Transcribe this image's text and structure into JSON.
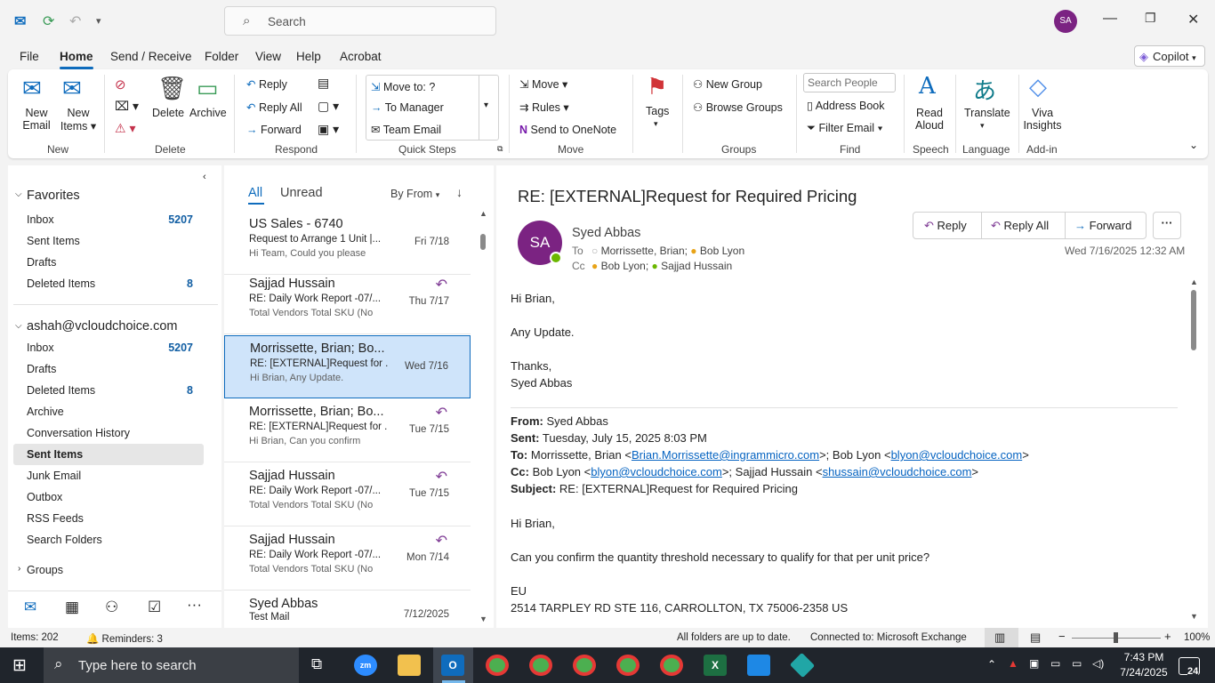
{
  "app": {
    "search_placeholder": "Search",
    "user_initials": "SA",
    "copilot": "Copilot"
  },
  "menu": [
    "File",
    "Home",
    "Send / Receive",
    "Folder",
    "View",
    "Help",
    "Acrobat"
  ],
  "ribbon": {
    "new_email": [
      "New",
      "Email"
    ],
    "new_items": [
      "New",
      "Items"
    ],
    "delete": "Delete",
    "archive": "Archive",
    "reply": "Reply",
    "reply_all": "Reply All",
    "forward": "Forward",
    "qs_move_to": "Move to: ?",
    "qs_to_manager": "To Manager",
    "qs_team_email": "Team Email",
    "move": "Move",
    "rules": "Rules",
    "send_onenote": "Send to OneNote",
    "tags": "Tags",
    "new_group": "New Group",
    "browse_groups": "Browse Groups",
    "search_people_placeholder": "Search People",
    "address_book": "Address Book",
    "filter_email": "Filter Email",
    "read_aloud": [
      "Read",
      "Aloud"
    ],
    "translate": "Translate",
    "viva_insights": [
      "Viva",
      "Insights"
    ],
    "groups": [
      "New",
      "Delete",
      "Respond",
      "Quick Steps",
      "Move",
      "Tags",
      "Groups",
      "Find",
      "Speech",
      "Language",
      "Add-in"
    ]
  },
  "nav": {
    "favorites": "Favorites",
    "fav_items": [
      {
        "label": "Inbox",
        "count": "5207"
      },
      {
        "label": "Sent Items",
        "count": ""
      },
      {
        "label": "Drafts",
        "count": ""
      },
      {
        "label": "Deleted Items",
        "count": "8"
      }
    ],
    "account": "ashah@vcloudchoice.com",
    "acct_items": [
      {
        "label": "Inbox",
        "count": "5207"
      },
      {
        "label": "Drafts",
        "count": ""
      },
      {
        "label": "Deleted Items",
        "count": "8"
      },
      {
        "label": "Archive",
        "count": ""
      },
      {
        "label": "Conversation History",
        "count": ""
      },
      {
        "label": "Sent Items",
        "count": ""
      },
      {
        "label": "Junk Email",
        "count": ""
      },
      {
        "label": "Outbox",
        "count": ""
      },
      {
        "label": "RSS Feeds",
        "count": ""
      },
      {
        "label": "Search Folders",
        "count": ""
      }
    ],
    "groups": "Groups"
  },
  "list": {
    "tab_all": "All",
    "tab_unread": "Unread",
    "sort": "By From",
    "items": [
      {
        "from": "US Sales - 6740",
        "subject": "Request to Arrange 1 Unit |...",
        "preview": "Hi Team,  Could you please",
        "date": "Fri 7/18",
        "replied": false
      },
      {
        "from": "Sajjad Hussain",
        "subject": "RE: Daily Work Report -07/...",
        "preview": "Total Vendors  Total SKU (No",
        "date": "Thu 7/17",
        "replied": true
      },
      {
        "from": "Morrissette, Brian; Bo...",
        "subject": "RE: [EXTERNAL]Request for ...",
        "preview": "Hi Brian,  Any Update.",
        "date": "Wed 7/16",
        "replied": false
      },
      {
        "from": "Morrissette, Brian; Bo...",
        "subject": "RE: [EXTERNAL]Request for ...",
        "preview": "Hi Brian,  Can you confirm",
        "date": "Tue 7/15",
        "replied": true
      },
      {
        "from": "Sajjad Hussain",
        "subject": "RE: Daily Work Report -07/...",
        "preview": "Total Vendors  Total SKU (No",
        "date": "Tue 7/15",
        "replied": true
      },
      {
        "from": "Sajjad Hussain",
        "subject": "RE: Daily Work Report -07/...",
        "preview": "Total Vendors  Total SKU (No",
        "date": "Mon 7/14",
        "replied": true
      },
      {
        "from": "Syed Abbas",
        "subject": "Test Mail",
        "preview": "",
        "date": "7/12/2025",
        "replied": false
      }
    ]
  },
  "reading": {
    "subject": "RE: [EXTERNAL]Request for Required Pricing",
    "sender": "Syed Abbas",
    "sender_initials": "SA",
    "to_label": "To",
    "to": [
      "Morrissette, Brian;",
      "Bob Lyon"
    ],
    "cc_label": "Cc",
    "cc": [
      "Bob Lyon;",
      "Sajjad Hussain"
    ],
    "reply": "Reply",
    "reply_all": "Reply All",
    "forward": "Forward",
    "date": "Wed 7/16/2025 12:32 AM",
    "body": [
      "Hi Brian,",
      "Any Update.",
      "Thanks,",
      "Syed Abbas"
    ],
    "quoted": {
      "from_label": "From:",
      "from": "Syed Abbas",
      "sent_label": "Sent:",
      "sent": "Tuesday, July 15, 2025 8:03 PM",
      "to_label": "To:",
      "to_name": "Morrissette, Brian <",
      "to_email": "Brian.Morrissette@ingrammicro.com",
      "to_rest": ">; Bob Lyon <",
      "to_email2": "blyon@vcloudchoice.com",
      "to_end": ">",
      "cc_label": "Cc:",
      "cc_name": "Bob Lyon <",
      "cc_email": "blyon@vcloudchoice.com",
      "cc_rest": ">; Sajjad Hussain <",
      "cc_email2": "shussain@vcloudchoice.com",
      "cc_end": ">",
      "subject_label": "Subject:",
      "subject": "RE: [EXTERNAL]Request for Required Pricing",
      "greeting": "Hi Brian,",
      "question": "Can you confirm the quantity threshold necessary to qualify for that per unit price?",
      "eu": "EU",
      "address": "2514 TARPLEY RD STE 116, CARROLLTON, TX 75006-2358 US"
    }
  },
  "status": {
    "items": "Items: 202",
    "reminders": "Reminders: 3",
    "sync": "All folders are up to date.",
    "connected": "Connected to: Microsoft Exchange",
    "zoom": "100%"
  },
  "taskbar": {
    "search": "Type here to search",
    "time": "7:43 PM",
    "date": "7/24/2025",
    "notif": "24"
  }
}
